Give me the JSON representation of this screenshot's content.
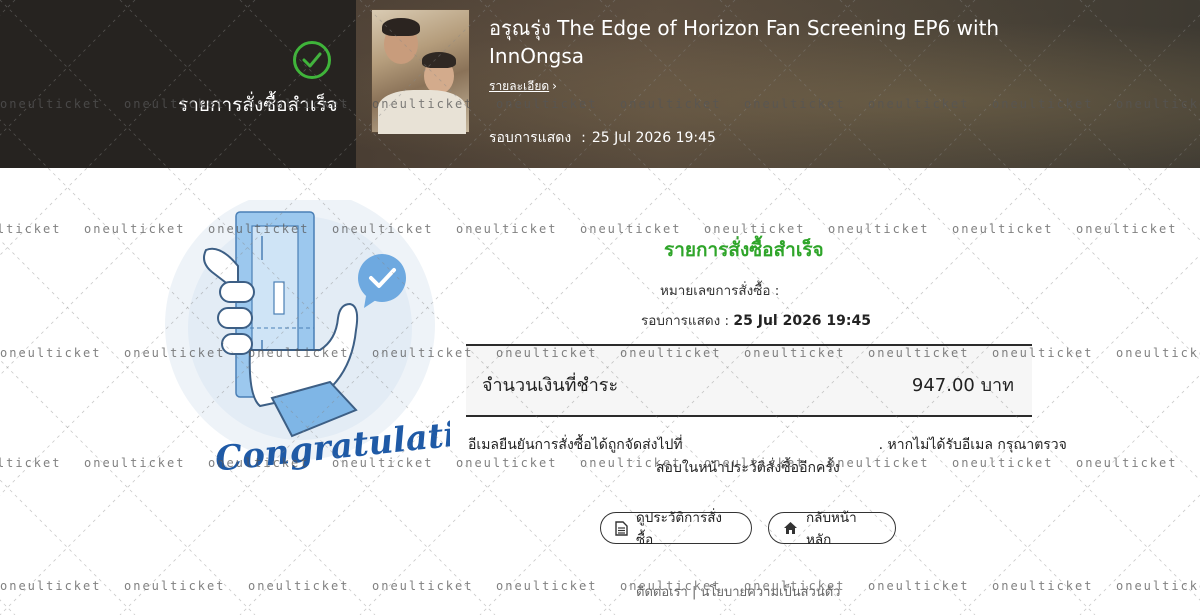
{
  "header": {
    "status_label": "รายการสั่งซื้อสำเร็จ",
    "event_title": "อรุณรุ่ง The Edge of Horizon Fan Screening EP6 with InnOngsa",
    "detail_link": "รายละเอียด",
    "show_label": "รอบการแสดง",
    "show_value": "25 Jul 2026 19:45"
  },
  "illustration": {
    "caption": "Congratulations"
  },
  "order": {
    "title": "รายการสั่งซื้อสำเร็จ",
    "order_no_label": "หมายเลขการสั่งซื้อ :",
    "show_label": "รอบการแสดง :",
    "show_value": "25 Jul 2026 19:45",
    "amount_label": "จำนวนเงินที่ชำระ",
    "amount_value": "947.00 บาท",
    "email_note_before": "อีเมลยืนยันการสั่งซื้อได้ถูกจัดส่งไปที่",
    "email_note_after": ". หากไม่ได้รับอีเมล กรุณาตรวจ",
    "email_note_line2": "สอบในหน้าประวัติสั่งซื้ออีกครั้ง"
  },
  "buttons": {
    "history": "ดูประวัติการสั่งซื้อ",
    "home": "กลับหน้าหลัก"
  },
  "footer": {
    "links": "ติดต่อเรา | นโยบายความเป็นส่วนตัว"
  },
  "watermark": {
    "text": "oneulticket"
  },
  "colors": {
    "success_green": "#3fb43a",
    "title_green": "#2fa52a",
    "illus_blue": "#7fb6e6",
    "illus_navy": "#1f5aa6"
  },
  "icons": [
    "check-circle-icon",
    "chevron-right-icon",
    "document-icon",
    "home-icon",
    "checkmark-bubble-icon"
  ]
}
